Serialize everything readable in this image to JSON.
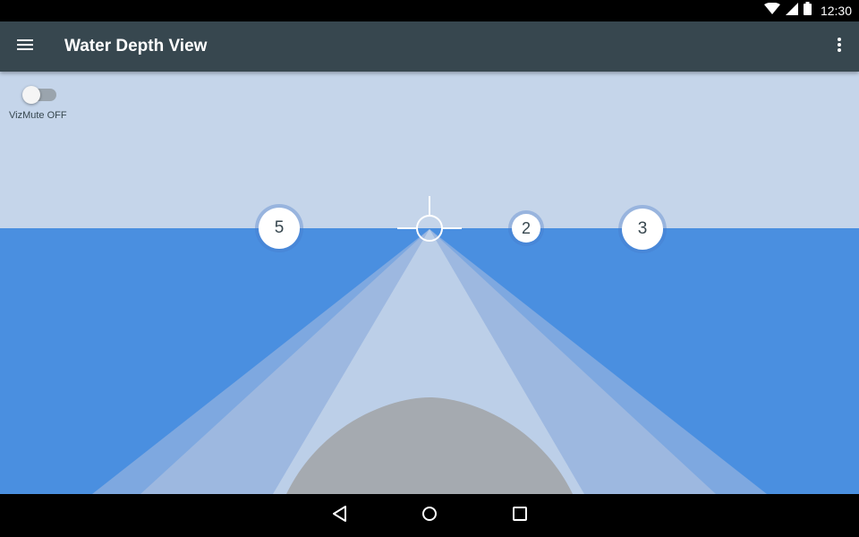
{
  "status_bar": {
    "time": "12:30",
    "icons": [
      "wifi-icon",
      "cell-signal-icon",
      "battery-icon"
    ]
  },
  "app_bar": {
    "title": "Water Depth View",
    "menu_icon": "hamburger-menu-icon",
    "overflow_icon": "more-vertical-icon"
  },
  "vizmute": {
    "label": "VizMute OFF",
    "state": "off"
  },
  "markers": [
    {
      "value": "5"
    },
    {
      "value": "2"
    },
    {
      "value": "3"
    }
  ],
  "nav_bar": {
    "buttons": [
      "back-icon",
      "home-icon",
      "recents-icon"
    ]
  },
  "colors": {
    "app_bar": "#37474f",
    "sky": "#c5d5ea",
    "water": "#4a8fe0",
    "beam_outer": "#7ea8e0",
    "beam_middle": "#9db8e0",
    "beam_inner": "#bccfe8",
    "hull": "#a5aab0"
  }
}
